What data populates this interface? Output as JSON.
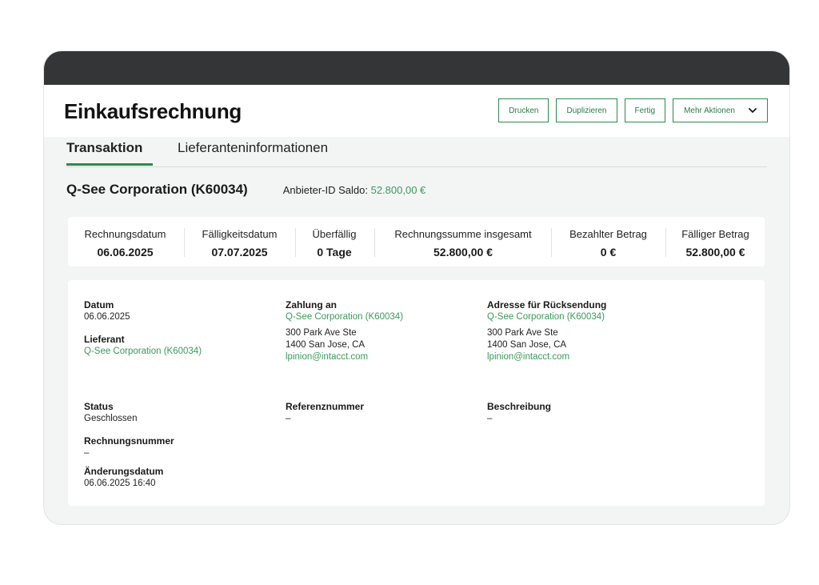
{
  "page": {
    "title": "Einkaufsrechnung"
  },
  "actions": {
    "print": "Drucken",
    "duplicate": "Duplizieren",
    "done": "Fertig",
    "more": "Mehr Aktionen"
  },
  "tabs": [
    {
      "label": "Transaktion",
      "active": true
    },
    {
      "label": "Lieferanteninformationen",
      "active": false
    }
  ],
  "vendor": {
    "name": "Q-See Corporation (K60034)",
    "saldo_label": "Anbieter-ID Saldo:",
    "saldo_value": "52.800,00 €"
  },
  "summary": [
    {
      "label": "Rechnungsdatum",
      "value": "06.06.2025"
    },
    {
      "label": "Fälligkeitsdatum",
      "value": "07.07.2025"
    },
    {
      "label": "Überfällig",
      "value": "0 Tage"
    },
    {
      "label": "Rechnungssumme insgesamt",
      "value": "52.800,00 €"
    },
    {
      "label": "Bezahlter Betrag",
      "value": "0 €"
    },
    {
      "label": "Fälliger Betrag",
      "value": "52.800,00 €"
    }
  ],
  "details": {
    "datum": {
      "label": "Datum",
      "value": "06.06.2025"
    },
    "lieferant": {
      "label": "Lieferant",
      "value": "Q-See Corporation (K60034)"
    },
    "zahlung": {
      "label": "Zahlung an",
      "name": "Q-See Corporation (K60034)",
      "street": "300 Park Ave Ste",
      "city": "1400 San Jose, CA",
      "email": "lpinion@intacct.com"
    },
    "ruecksendung": {
      "label": "Adresse für Rücksendung",
      "name": "Q-See Corporation (K60034)",
      "street": "300 Park Ave Ste",
      "city": "1400 San Jose, CA",
      "email": "lpinion@intacct.com"
    },
    "status": {
      "label": "Status",
      "value": "Geschlossen"
    },
    "referenz": {
      "label": "Referenznummer",
      "value": "–"
    },
    "beschreibung": {
      "label": "Beschreibung",
      "value": "–"
    },
    "rechnungsnummer": {
      "label": "Rechnungsnummer",
      "value": "–"
    },
    "aenderung": {
      "label": "Änderungsdatum",
      "value": "06.06.2025 16:40"
    }
  },
  "colors": {
    "accent": "#2d8a4d",
    "link": "#3a9a5a",
    "titlebar": "#343536",
    "background": "#f3f5f4"
  },
  "icons": {
    "more_actions": "chevron-down-icon"
  }
}
